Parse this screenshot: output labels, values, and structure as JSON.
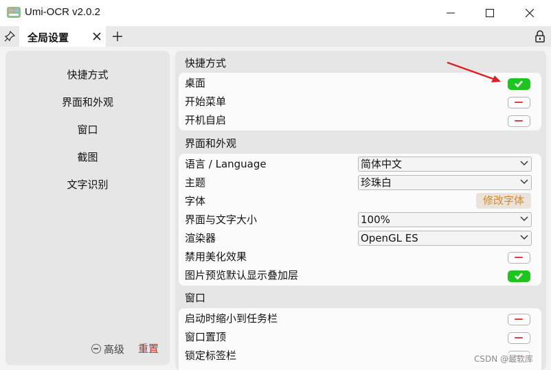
{
  "window": {
    "title": "Umi-OCR v2.0.2",
    "icons": [
      "app-icon",
      "minimize-icon",
      "maximize-icon",
      "close-icon"
    ]
  },
  "tabs": {
    "active_label": "全局设置",
    "icons": [
      "pin-icon",
      "tab-close-icon",
      "add-tab-icon",
      "lock-icon"
    ]
  },
  "sidebar": {
    "items": [
      {
        "label": "快捷方式"
      },
      {
        "label": "界面和外观"
      },
      {
        "label": "窗口"
      },
      {
        "label": "截图"
      },
      {
        "label": "文字识别"
      }
    ],
    "advanced_label": "高级",
    "reset_label": "重置"
  },
  "sections": {
    "shortcuts": {
      "title": "快捷方式",
      "rows": [
        {
          "label": "桌面",
          "enabled": true
        },
        {
          "label": "开始菜单",
          "enabled": false
        },
        {
          "label": "开机自启",
          "enabled": false
        }
      ]
    },
    "appearance": {
      "title": "界面和外观",
      "language": {
        "label": "语言 / Language",
        "value": "简体中文"
      },
      "theme": {
        "label": "主题",
        "value": "珍珠白"
      },
      "font": {
        "label": "字体",
        "button": "修改字体"
      },
      "scale": {
        "label": "界面与文字大小",
        "value": "100%"
      },
      "renderer": {
        "label": "渲染器",
        "value": "OpenGL ES"
      },
      "disable_effects": {
        "label": "禁用美化效果",
        "enabled": false
      },
      "preview_overlay": {
        "label": "图片预览默认显示叠加层",
        "enabled": true
      }
    },
    "window": {
      "title": "窗口",
      "rows": [
        {
          "label": "启动时缩小到任务栏",
          "enabled": false
        },
        {
          "label": "窗口置顶",
          "enabled": false
        },
        {
          "label": "锁定标签栏",
          "enabled": false
        }
      ]
    }
  },
  "colors": {
    "toggle_on": "#1fc41f",
    "toggle_off_mark": "#e63b3b",
    "reset_text": "#e02020",
    "font_button_text": "#d48a2a",
    "annotation_arrow": "#e02020"
  },
  "watermark": "CSDN @最软库"
}
